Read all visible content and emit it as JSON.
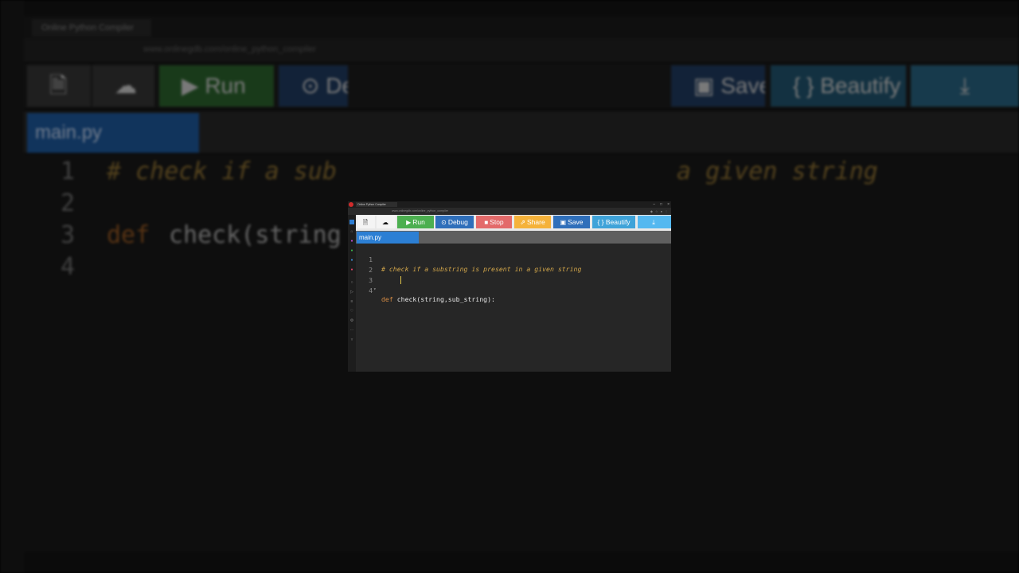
{
  "browser": {
    "tab_title": "Online Python Compiler",
    "url": "www.onlinegdb.com/online_python_compiler",
    "window_controls": [
      "–",
      "□",
      "×"
    ]
  },
  "toolbar": {
    "new_file_icon": "file-icon",
    "upload_icon": "cloud-upload-icon",
    "run_label": "Run",
    "debug_label": "Debug",
    "stop_label": "Stop",
    "share_label": "Share",
    "save_label": "Save",
    "beautify_label": "{ } Beautify",
    "download_icon": "download-icon"
  },
  "colors": {
    "run": "#4caf50",
    "debug": "#2f6fba",
    "stop": "#e36a6a",
    "share": "#f5b23a",
    "save": "#2f6fba",
    "beautify": "#3fa3d9",
    "download": "#54b8f0",
    "file_tab": "#2c7fd4"
  },
  "file_tab": "main.py",
  "editor": {
    "lines": [
      {
        "num": "1",
        "fold": "",
        "parts": [
          {
            "cls": "cmt",
            "text": "# check if a substring is present in a given string"
          }
        ]
      },
      {
        "num": "2",
        "fold": "",
        "parts": []
      },
      {
        "num": "3",
        "fold": "▾",
        "parts": [
          {
            "cls": "kw",
            "text": "def "
          },
          {
            "cls": "txt",
            "text": "check(string,sub_string):"
          }
        ]
      },
      {
        "num": "4",
        "fold": "",
        "parts": []
      }
    ]
  },
  "background": {
    "tab_title": "Online Python Compiler",
    "url": "www.onlinegdb.com/online_python_compiler",
    "run_label": "Run",
    "debug_label": "De",
    "save_label": "Save",
    "beautify_label": "{ } Beautify",
    "file_tab": "main.py",
    "line1_left": "# check if a sub",
    "line1_right": "a given string",
    "line3_kw": "def",
    "line3_text": "check(string"
  }
}
